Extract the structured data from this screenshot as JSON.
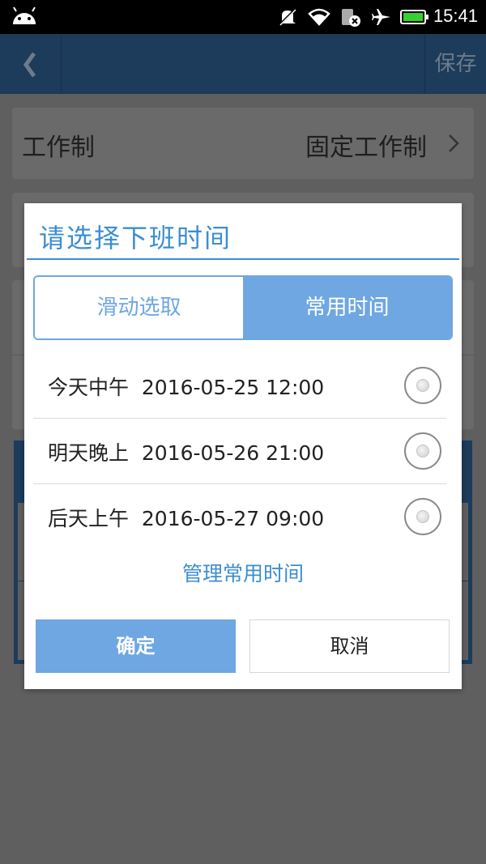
{
  "status_bar": {
    "time": "15:41",
    "icons": [
      "android-icon",
      "mute-icon",
      "wifi-icon",
      "sim-off-icon",
      "airplane-icon",
      "battery-icon"
    ],
    "battery_color": "#35d22e"
  },
  "header": {
    "back_icon": "chevron-left-icon",
    "save_label": "保存"
  },
  "background": {
    "row1_label": "工作制",
    "row1_value": "固定工作制"
  },
  "dialog": {
    "title": "请选择下班时间",
    "tabs": [
      {
        "label": "滑动选取",
        "selected": false
      },
      {
        "label": "常用时间",
        "selected": true
      }
    ],
    "options": [
      {
        "label": "今天中午  2016-05-25 12:00",
        "checked": false
      },
      {
        "label": "明天晚上  2016-05-26 21:00",
        "checked": false
      },
      {
        "label": "后天上午  2016-05-27 09:00",
        "checked": false
      }
    ],
    "manage_link": "管理常用时间",
    "confirm_label": "确定",
    "cancel_label": "取消"
  },
  "colors": {
    "accent": "#3c8ed0",
    "tab_selected": "#6ea7e2",
    "header_bg": "#1d3b5b",
    "overlay": "#5f5f5f"
  }
}
